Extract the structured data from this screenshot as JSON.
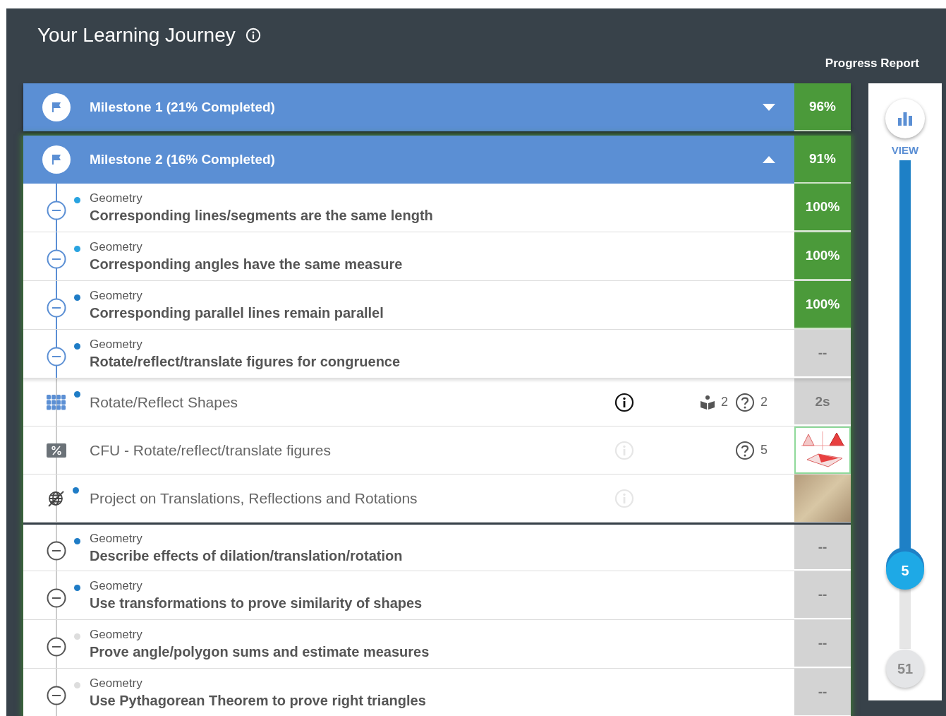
{
  "header": {
    "title": "Your Learning Journey",
    "report_label": "Progress Report"
  },
  "milestones": [
    {
      "title": "Milestone 1 (21% Completed)",
      "expanded": false,
      "score": "96%",
      "mastered": true
    },
    {
      "title": "Milestone 2 (16% Completed)",
      "expanded": true,
      "score": "91%",
      "mastered": true,
      "items": [
        {
          "kind": "standard",
          "category": "Geometry",
          "title": "Corresponding lines/segments are the same length",
          "color": "#29a3e0",
          "highlighted": true,
          "score": "100%",
          "mastered": true
        },
        {
          "kind": "standard",
          "category": "Geometry",
          "title": "Corresponding angles have the same measure",
          "color": "#29a3e0",
          "highlighted": true,
          "score": "100%",
          "mastered": true
        },
        {
          "kind": "standard",
          "category": "Geometry",
          "title": "Corresponding parallel lines remain parallel",
          "color": "#1f7cc6",
          "highlighted": true,
          "score": "100%",
          "mastered": true
        },
        {
          "kind": "standard",
          "category": "Geometry",
          "title": "Rotate/reflect/translate figures for congruence",
          "color": "#1f7cc6",
          "highlighted": true,
          "score": "--",
          "mastered": false
        },
        {
          "kind": "lesson",
          "title": "Rotate/Reflect Shapes",
          "color": "#1f7cc6",
          "info_enabled": true,
          "resources": "2",
          "questions": "2",
          "score": "2s"
        },
        {
          "kind": "quiz",
          "title": "CFU - Rotate/reflect/translate figures",
          "info_enabled": false,
          "questions": "5"
        },
        {
          "kind": "project",
          "title": "Project on Translations, Reflections and Rotations",
          "color": "#1f7cc6",
          "info_enabled": false
        },
        {
          "kind": "standard",
          "category": "Geometry",
          "title": "Describe effects of dilation/translation/rotation",
          "color": "#1f7cc6",
          "highlighted": false,
          "score": "--",
          "mastered": false
        },
        {
          "kind": "standard",
          "category": "Geometry",
          "title": "Use transformations to prove similarity of shapes",
          "color": "#1f7cc6",
          "highlighted": false,
          "score": "--",
          "mastered": false
        },
        {
          "kind": "standard",
          "category": "Geometry",
          "title": "Prove angle/polygon sums and estimate measures",
          "color": "#dddddd",
          "highlighted": false,
          "score": "--",
          "mastered": false
        },
        {
          "kind": "standard",
          "category": "Geometry",
          "title": "Use Pythagorean Theorem to prove right triangles",
          "color": "#dddddd",
          "highlighted": false,
          "score": "--",
          "mastered": false
        }
      ]
    }
  ],
  "slider": {
    "label": "VIEW",
    "level": 0.84,
    "value": "5",
    "max": "51"
  }
}
